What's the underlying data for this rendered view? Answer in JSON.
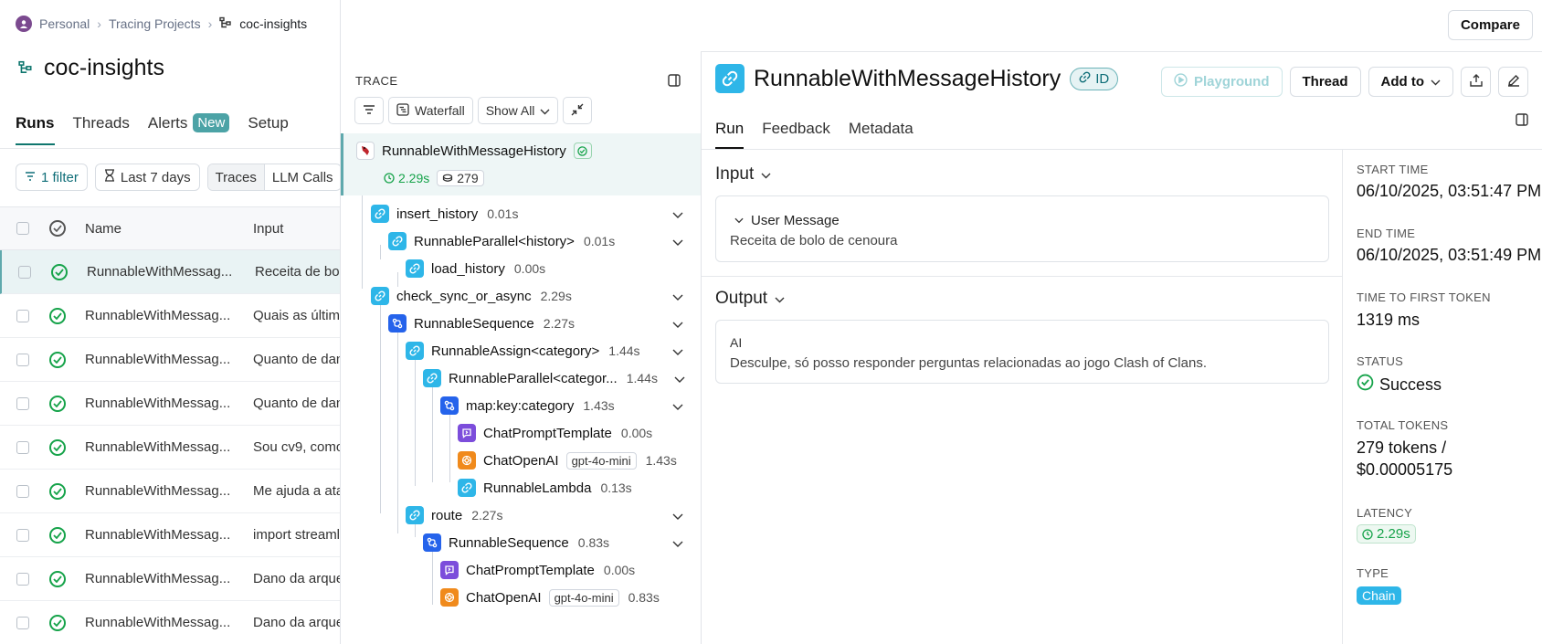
{
  "breadcrumb": {
    "workspace": "Personal",
    "section": "Tracing Projects",
    "project": "coc-insights"
  },
  "project_title": "coc-insights",
  "left_tabs": [
    {
      "label": "Runs",
      "badge": ""
    },
    {
      "label": "Threads",
      "badge": ""
    },
    {
      "label": "Alerts",
      "badge": "New"
    },
    {
      "label": "Setup",
      "badge": ""
    }
  ],
  "filters": {
    "filter_label": "1 filter",
    "time_label": "Last 7 days",
    "segments": [
      "Traces",
      "LLM Calls"
    ]
  },
  "runs_table": {
    "headers": {
      "name": "Name",
      "input": "Input"
    },
    "rows": [
      {
        "name": "RunnableWithMessag...",
        "input": "Receita de bolo"
      },
      {
        "name": "RunnableWithMessag...",
        "input": "Quais as última"
      },
      {
        "name": "RunnableWithMessag...",
        "input": "Quanto de dano"
      },
      {
        "name": "RunnableWithMessag...",
        "input": "Quanto de dano"
      },
      {
        "name": "RunnableWithMessag...",
        "input": "Sou cv9, como"
      },
      {
        "name": "RunnableWithMessag...",
        "input": "Me ajuda a atac"
      },
      {
        "name": "RunnableWithMessag...",
        "input": "import streamli"
      },
      {
        "name": "RunnableWithMessag...",
        "input": "Dano da arquei"
      },
      {
        "name": "RunnableWithMessag...",
        "input": "Dano da arquei"
      }
    ]
  },
  "topbar": {
    "compare_label": "Compare"
  },
  "trace": {
    "label": "TRACE",
    "waterfall_label": "Waterfall",
    "show_all_label": "Show All",
    "root": {
      "name": "RunnableWithMessageHistory",
      "duration": "2.29s",
      "tokens": "279"
    },
    "nodes": [
      {
        "name": "insert_history",
        "duration": "0.01s",
        "icon": "link-icon",
        "model": ""
      },
      {
        "name": "RunnableParallel<history>",
        "duration": "0.01s",
        "icon": "link-icon",
        "model": ""
      },
      {
        "name": "load_history",
        "duration": "0.00s",
        "icon": "link-icon",
        "model": ""
      },
      {
        "name": "check_sync_or_async",
        "duration": "2.29s",
        "icon": "link-icon",
        "model": ""
      },
      {
        "name": "RunnableSequence",
        "duration": "2.27s",
        "icon": "sequence-icon",
        "model": ""
      },
      {
        "name": "RunnableAssign<category>",
        "duration": "1.44s",
        "icon": "link-icon",
        "model": ""
      },
      {
        "name": "RunnableParallel<categor...",
        "duration": "1.44s",
        "icon": "link-icon",
        "model": ""
      },
      {
        "name": "map:key:category",
        "duration": "1.43s",
        "icon": "sequence-icon",
        "model": ""
      },
      {
        "name": "ChatPromptTemplate",
        "duration": "0.00s",
        "icon": "prompt-icon",
        "model": ""
      },
      {
        "name": "ChatOpenAI",
        "duration": "1.43s",
        "icon": "openai-icon",
        "model": "gpt-4o-mini"
      },
      {
        "name": "RunnableLambda",
        "duration": "0.13s",
        "icon": "link-icon",
        "model": ""
      },
      {
        "name": "route",
        "duration": "2.27s",
        "icon": "link-icon",
        "model": ""
      },
      {
        "name": "RunnableSequence",
        "duration": "0.83s",
        "icon": "sequence-icon",
        "model": ""
      },
      {
        "name": "ChatPromptTemplate",
        "duration": "0.00s",
        "icon": "prompt-icon",
        "model": ""
      },
      {
        "name": "ChatOpenAI",
        "duration": "0.83s",
        "icon": "openai-icon",
        "model": "gpt-4o-mini"
      }
    ]
  },
  "run": {
    "title": "RunnableWithMessageHistory",
    "id_label": "ID",
    "actions": {
      "playground": "Playground",
      "thread": "Thread",
      "add_to": "Add to"
    },
    "tabs": [
      "Run",
      "Feedback",
      "Metadata"
    ],
    "input": {
      "section": "Input",
      "role": "User Message",
      "text": "Receita de bolo de cenoura"
    },
    "output": {
      "section": "Output",
      "role": "AI",
      "text": "Desculpe, só posso responder perguntas relacionadas ao jogo Clash of Clans."
    },
    "meta": {
      "start_time_label": "START TIME",
      "start_time": "06/10/2025, 03:51:47 PM",
      "end_time_label": "END TIME",
      "end_time": "06/10/2025, 03:51:49 PM",
      "ttft_label": "TIME TO FIRST TOKEN",
      "ttft": "1319 ms",
      "status_label": "STATUS",
      "status": "Success",
      "tokens_label": "TOTAL TOKENS",
      "tokens_line1": "279 tokens /",
      "tokens_line2": "$0.00005175",
      "latency_label": "LATENCY",
      "latency": "2.29s",
      "type_label": "TYPE",
      "type": "Chain"
    }
  },
  "colors": {
    "accent": "#0f766e",
    "success": "#16a34a",
    "link_icon": "#2eb6e8",
    "sequence_icon": "#2563eb",
    "prompt_icon": "#7c4ddb",
    "openai_icon": "#f08a1c"
  }
}
